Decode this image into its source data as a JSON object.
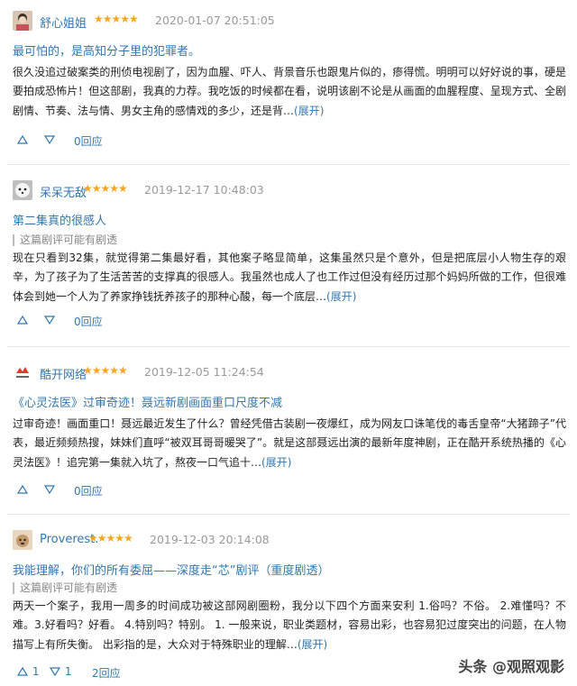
{
  "reviews": [
    {
      "username": "舒心姐姐",
      "stars": "★★★★★",
      "date": "2020-01-07 20:51:05",
      "title": "最可怕的，是高知分子里的犯罪者。",
      "spoiler": "",
      "body": "很久没追过破案类的刑侦电视剧了，因为血腥、吓人、背景音乐也跟鬼片似的，瘆得慌。明明可以好好说的事，硬是要拍成恐怖片！但这部剧，我真的力荐。我吃饭的时候都在看，说明该剧不论是从画面的血腥程度、呈现方式、全剧剧情、节奏、法与情、男女主角的感情戏的多少，还是背…",
      "expand": "(展开)",
      "up": "",
      "down": "",
      "replies": "0回应"
    },
    {
      "username": "呆呆无敌",
      "stars": "★★★★★",
      "date": "2019-12-17 10:48:03",
      "title": "第二集真的很感人",
      "spoiler": "这篇剧评可能有剧透",
      "body": "现在只看到32集，就觉得第二集最好看，其他案子略显简单，这集虽然只是个意外，但是把底层小人物生存的艰辛，为了孩子为了生活苦苦的支撑真的很感人。我虽然也成人了也工作过但没有经历过那个妈妈所做的工作，但很难体会到她一个人为了养家挣钱抚养孩子的那种心酸，每一个底层…",
      "expand": "(展开)",
      "up": "",
      "down": "",
      "replies": "0回应"
    },
    {
      "username": "酷开网络",
      "stars": "★★★★★",
      "date": "2019-12-05 11:24:54",
      "title": "《心灵法医》过审奇迹！聂远新剧画面重口尺度不减",
      "spoiler": "",
      "body": "过审奇迹！画面重口！聂远最近发生了什么？曾经凭借古装剧一夜爆红，成为网友口诛笔伐的毒舌皇帝“大猪蹄子”代表，最近频频热搜，妹妹们直呼“被双耳哥哥暖哭了”。就是这部聂远出演的最新年度神剧，正在酷开系统热播的《心灵法医》！追完第一集就入坑了，熬夜一口气追十…",
      "expand": "(展开)",
      "up": "",
      "down": "",
      "replies": "0回应"
    },
    {
      "username": "Proverest.",
      "stars": "★★★★★",
      "date": "2019-12-03 20:14:08",
      "title": "我能理解，你们的所有委屈——深度走“芯”剧评（重度剧透）",
      "spoiler": "这篇剧评可能有剧透",
      "body": "两天一个案子，我用一周多的时间成功被这部网剧圈粉，我分以下四个方面来安利 1.俗吗？不俗。 2.难懂吗？不难。3.好看吗？好看。 4.特别吗？特别。 1. 一般来说，职业类题材，容易出彩，也容易犯过度突出的问题，在人物描写上有所失衡。 出彩指的是，大众对于特殊职业的理解…",
      "expand": "(展开)",
      "up": "1",
      "down": "1",
      "replies": "2回应"
    }
  ],
  "watermark": "头条 @观照观影",
  "colors": {
    "link": "#3377aa",
    "star": "#f5a623",
    "meta": "#999999",
    "text": "#222222"
  }
}
